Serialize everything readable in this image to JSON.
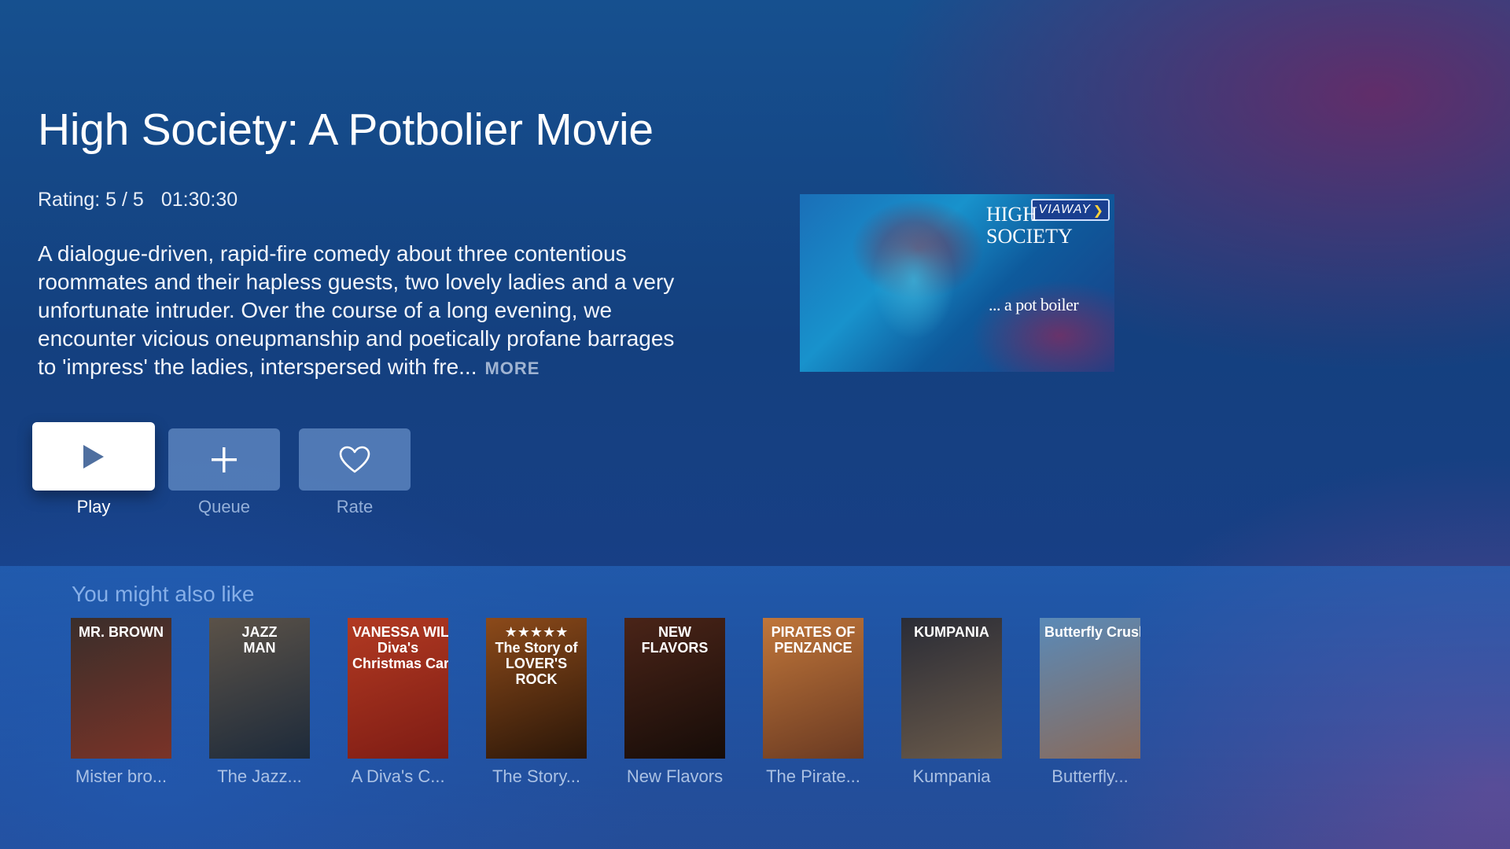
{
  "movie": {
    "title": "High Society: A Potbolier Movie",
    "rating": "Rating: 5 / 5",
    "duration": "01:30:30",
    "description": "A dialogue-driven, rapid-fire comedy about three contentious roommates and their hapless guests, two lovely ladies and a very unfortunate intruder. Over the course of a long evening, we encounter vicious oneupmanship and poetically profane barrages to 'impress' the ladies, interspersed with fre...",
    "more_label": "MORE",
    "artwork": {
      "brand": "VIAWAY",
      "brand_chevron": "❯",
      "title": "HIGH\nSOCIETY",
      "subtitle": "... a pot boiler"
    }
  },
  "actions": {
    "play_label": "Play",
    "queue_label": "Queue",
    "rate_label": "Rate",
    "play_icon": "play-icon",
    "queue_icon": "plus-icon",
    "rate_icon": "heart-icon"
  },
  "related": {
    "heading": "You might also like",
    "items": [
      {
        "caption": "Mister bro...",
        "poster_text": "MR. BROWN",
        "colors": [
          "#3a2e2a",
          "#7a3328"
        ]
      },
      {
        "caption": "The Jazz...",
        "poster_text": "JAZZ\nMAN",
        "colors": [
          "#5b5248",
          "#1d2a3a"
        ]
      },
      {
        "caption": "A Diva's C...",
        "poster_text": "VANESSA WILLIAMS\nDiva's\nChristmas Carol",
        "colors": [
          "#b23a22",
          "#7e1c14"
        ]
      },
      {
        "caption": "The Story...",
        "poster_text": "★★★★★\nThe Story of\nLOVER'S\nROCK",
        "colors": [
          "#8c4a1a",
          "#2a1608"
        ]
      },
      {
        "caption": "New Flavors",
        "poster_text": "NEW\nFLAVORS",
        "colors": [
          "#4a2418",
          "#160c08"
        ]
      },
      {
        "caption": "The Pirate...",
        "poster_text": "PIRATES OF\nPENZANCE",
        "colors": [
          "#c0763a",
          "#6a3a22"
        ]
      },
      {
        "caption": "Kumpania",
        "poster_text": "KUMPANIA",
        "colors": [
          "#2a2c36",
          "#6a5a4a"
        ]
      },
      {
        "caption": "Butterfly...",
        "poster_text": "Butterfly Crush",
        "colors": [
          "#5a8ab8",
          "#8a6a5a"
        ]
      }
    ]
  }
}
